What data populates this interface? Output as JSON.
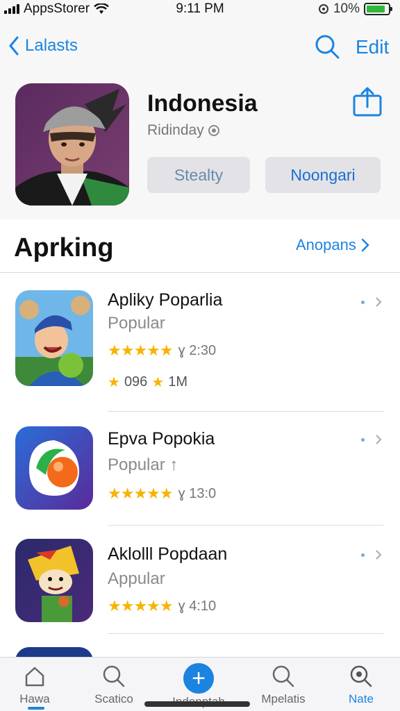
{
  "status": {
    "carrier": "AppsStorer",
    "time": "9:11 PM",
    "battery_text": "10%",
    "battery_level": 0.85
  },
  "nav": {
    "back_label": "Lalasts",
    "edit_label": "Edit"
  },
  "header": {
    "title": "Indonesia",
    "subtitle": "Ridinday",
    "button1": "Stealty",
    "button2": "Noongari"
  },
  "section": {
    "title": "Aprking",
    "link": "Anopans"
  },
  "apps": [
    {
      "name": "Apliky Poparlia",
      "category": "Popular",
      "stars": "★★★★★",
      "count": "ɣ 2:30",
      "extra_badge": "096",
      "extra_count": "1M"
    },
    {
      "name": "Epva Popokia",
      "category": "Popular ↑",
      "stars": "★★★★★",
      "count": "ɣ 13:0"
    },
    {
      "name": "Aklolll Popdaan",
      "category": "Appular",
      "stars": "★★★★★",
      "count": "ɣ 4:10"
    }
  ],
  "tabs": [
    "Hawa",
    "Scatico",
    "Indonptah",
    "Mpelatis",
    "Nate"
  ],
  "colors": {
    "accent": "#1a84e0",
    "star": "#f5b400",
    "battery": "#2fb83c"
  }
}
